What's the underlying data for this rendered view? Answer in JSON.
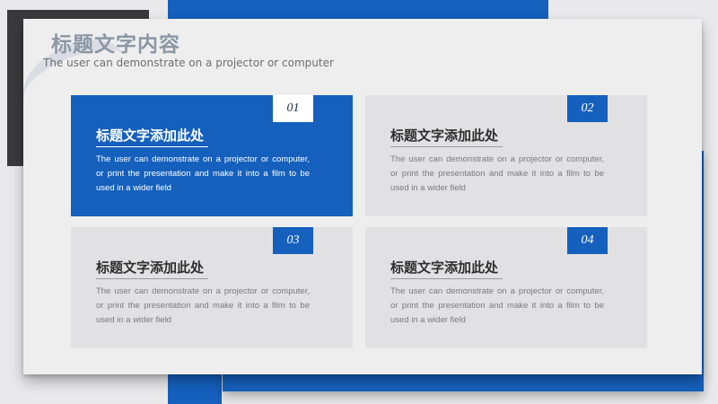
{
  "slide": {
    "title": "标题文字内容",
    "subtitle": "The user can demonstrate on a projector or computer"
  },
  "colors": {
    "accent": "#1560bd",
    "dark_block": "#3a3a3c",
    "box_gray": "#e1e1e3",
    "title_gray": "#8c97a5"
  },
  "boxes": [
    {
      "number": "01",
      "heading": "标题文字添加此处",
      "text": "The user can demonstrate on a projector or computer, or print the presentation and make it into a film to be used in a wider field",
      "highlighted": true
    },
    {
      "number": "02",
      "heading": "标题文字添加此处",
      "text": "The user can demonstrate on a projector or computer, or print the presentation and make it into a film to be used in a wider field",
      "highlighted": false
    },
    {
      "number": "03",
      "heading": "标题文字添加此处",
      "text": "The user can demonstrate on a projector or computer, or print the presentation and make it into a film to be used in a wider field",
      "highlighted": false
    },
    {
      "number": "04",
      "heading": "标题文字添加此处",
      "text": "The user can demonstrate on a projector or computer, or print the presentation and make it into a film to be used in a wider field",
      "highlighted": false
    }
  ]
}
